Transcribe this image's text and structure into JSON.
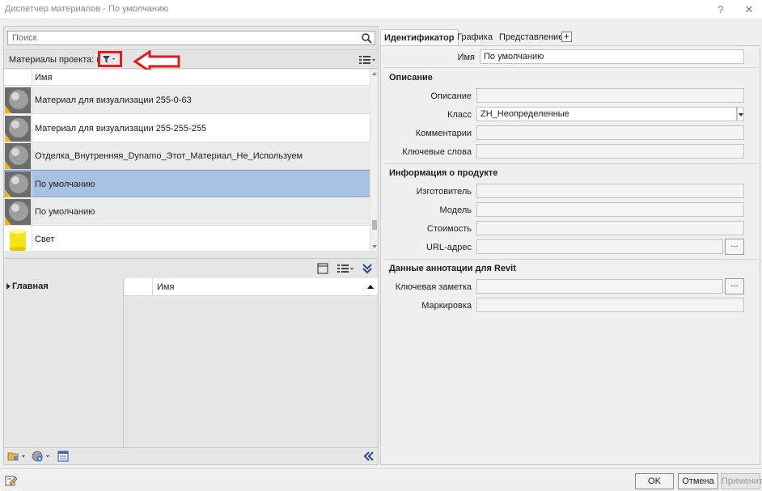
{
  "window": {
    "title": "Диспетчер материалов - По умолчанию",
    "help": "?",
    "close": "✕"
  },
  "search": {
    "placeholder": "Поиск"
  },
  "project_materials": {
    "label": "Материалы проекта: все",
    "column_name": "Имя",
    "items": [
      {
        "name": "Материал для визуализации 255-0-63",
        "icon": "sphere-gray-icon"
      },
      {
        "name": "Материал для визуализации 255-255-255",
        "icon": "sphere-gray-icon"
      },
      {
        "name": "Отделка_Внутренняя_Dynamo_Этот_Материал_Не_Используем",
        "icon": "sphere-gray-icon"
      },
      {
        "name": "По умолчанию",
        "icon": "sphere-gray-icon",
        "selected": true
      },
      {
        "name": "По умолчанию",
        "icon": "sphere-gray-icon"
      },
      {
        "name": "Свет",
        "icon": "cylinder-yellow-icon"
      }
    ]
  },
  "library": {
    "tree_root": "Главная",
    "column_name": "Имя"
  },
  "tabs": [
    {
      "label": "Идентификатор",
      "active": true
    },
    {
      "label": "Графика"
    },
    {
      "label": "Представление"
    }
  ],
  "identity": {
    "name_label": "Имя",
    "name_value": "По умолчанию",
    "sections": {
      "description": "Описание",
      "product_info": "Информация о продукте",
      "revit_annotation": "Данные аннотации для Revit"
    },
    "fields": {
      "description_label": "Описание",
      "description_value": "",
      "class_label": "Класс",
      "class_value": "ZH_Неопределенные",
      "comments_label": "Комментарии",
      "comments_value": "",
      "keywords_label": "Ключевые слова",
      "keywords_value": "",
      "manufacturer_label": "Изготовитель",
      "manufacturer_value": "",
      "model_label": "Модель",
      "model_value": "",
      "cost_label": "Стоимость",
      "cost_value": "",
      "url_label": "URL-адрес",
      "url_value": "",
      "keynote_label": "Ключевая заметка",
      "keynote_value": "",
      "mark_label": "Маркировка",
      "mark_value": ""
    },
    "browse_label": "..."
  },
  "buttons": {
    "ok": "OK",
    "cancel": "Отмена",
    "apply": "Применить"
  },
  "colors": {
    "highlight": "#e01c1c",
    "selection": "#a9c2e3"
  }
}
